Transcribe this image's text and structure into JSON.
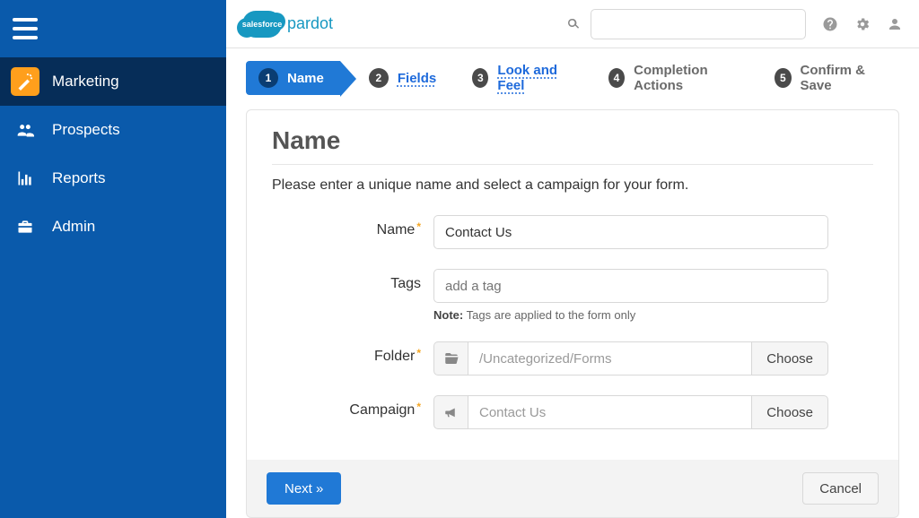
{
  "brand": {
    "cloud_text": "salesforce",
    "sub_text": "pardot"
  },
  "topbar": {
    "search_placeholder": ""
  },
  "sidebar": {
    "items": [
      {
        "label": "Marketing"
      },
      {
        "label": "Prospects"
      },
      {
        "label": "Reports"
      },
      {
        "label": "Admin"
      }
    ]
  },
  "wizard": {
    "steps": [
      {
        "num": "1",
        "label": "Name"
      },
      {
        "num": "2",
        "label": "Fields"
      },
      {
        "num": "3",
        "label": "Look and Feel"
      },
      {
        "num": "4",
        "label": "Completion Actions"
      },
      {
        "num": "5",
        "label": "Confirm & Save"
      }
    ]
  },
  "panel": {
    "heading": "Name",
    "instruction": "Please enter a unique name and select a campaign for your form.",
    "labels": {
      "name": "Name",
      "tags": "Tags",
      "folder": "Folder",
      "campaign": "Campaign"
    },
    "values": {
      "name": "Contact Us",
      "tags_placeholder": "add a tag",
      "folder": "/Uncategorized/Forms",
      "campaign": "Contact Us"
    },
    "note_label": "Note:",
    "note_text": "Tags are applied to the form only",
    "choose_label": "Choose"
  },
  "footer": {
    "next": "Next »",
    "cancel": "Cancel"
  }
}
